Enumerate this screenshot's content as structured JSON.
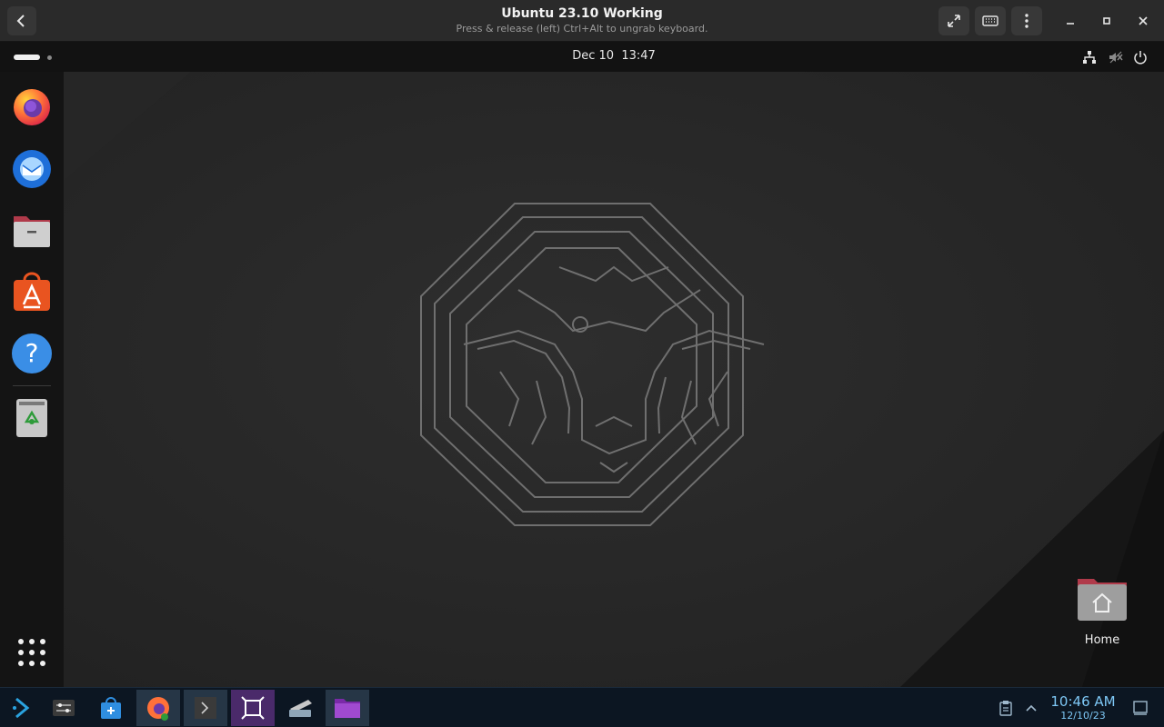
{
  "vm_window": {
    "title": "Ubuntu 23.10 Working",
    "subtitle": "Press & release (left) Ctrl+Alt to ungrab keyboard.",
    "buttons": [
      "back-icon",
      "fullscreen-icon",
      "keyboard-icon",
      "menu-icon",
      "minimize-icon",
      "maximize-icon",
      "close-icon"
    ]
  },
  "topbar": {
    "date": "Dec 10",
    "time": "13:47",
    "tray": [
      "network-icon",
      "volume-muted-icon",
      "power-icon"
    ]
  },
  "dock": {
    "apps": [
      {
        "name": "firefox-icon",
        "color": "#ff7139"
      },
      {
        "name": "thunderbird-icon",
        "color": "#2c7de0"
      },
      {
        "name": "files-icon",
        "color": "#b7b7b7"
      },
      {
        "name": "app-center-icon",
        "color": "#e95420"
      },
      {
        "name": "help-icon",
        "color": "#3a8ee6"
      },
      {
        "name": "trash-icon",
        "color": "#bdbdbd"
      }
    ],
    "show_apps": "grid-icon"
  },
  "desktop": {
    "home_label": "Home",
    "wallpaper": "mantic-minotaur-maze"
  },
  "taskbar": {
    "time": "10:46 AM",
    "date": "12/10/23",
    "accent": "#7ec8f6"
  }
}
